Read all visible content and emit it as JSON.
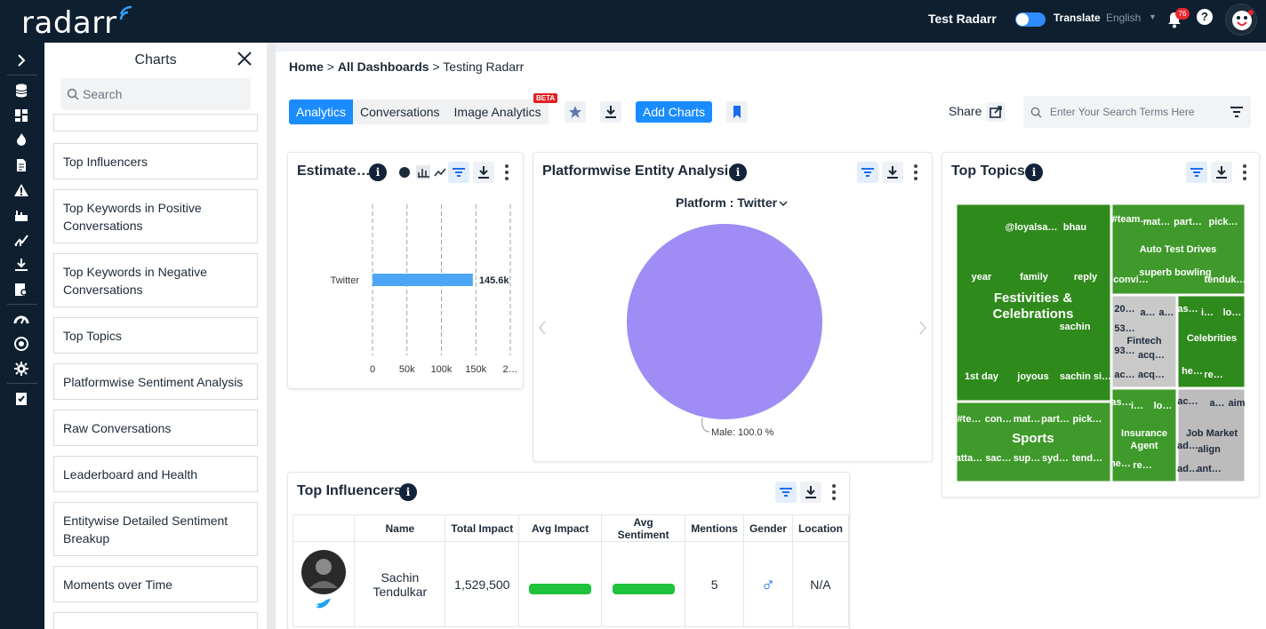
{
  "app": {
    "logo_text": "radarr"
  },
  "topbar": {
    "user_name": "Test Radarr",
    "translate_label": "Translate",
    "language": "English",
    "notifications": "76"
  },
  "charts_panel": {
    "title": "Charts",
    "search_placeholder": "Search",
    "items": [
      "Top Influencers",
      "Top Keywords in Positive Conversations",
      "Top Keywords in Negative Conversations",
      "Top Topics",
      "Platformwise Sentiment Analysis",
      "Raw Conversations",
      "Leaderboard and Health",
      "Entitywise Detailed Sentiment Breakup",
      "Moments over Time"
    ]
  },
  "breadcrumb": {
    "home": "Home",
    "sep1": ">",
    "all_dashboards": "All Dashboards",
    "sep2": ">",
    "current": "Testing Radarr"
  },
  "tabs": [
    "Analytics",
    "Conversations",
    "Image Analytics"
  ],
  "beta_badge": "BETA",
  "toolbar": {
    "add_charts": "Add Charts",
    "share": "Share",
    "search_placeholder": "Enter Your Search Terms Here"
  },
  "estimated_card": {
    "title": "Estimate…",
    "chart_data": {
      "type": "bar",
      "orientation": "horizontal",
      "categories": [
        "Twitter"
      ],
      "values": [
        145600
      ],
      "data_labels": [
        "145.6k"
      ],
      "xlim": [
        0,
        200000
      ],
      "x_ticks": [
        "0",
        "50k",
        "100k",
        "150k",
        "2…"
      ],
      "grid": true,
      "bar_color": "#4da6f5"
    }
  },
  "platformwise_card": {
    "title": "Platformwise Entity Analysis",
    "platform_selector": "Platform : Twitter",
    "chart_data": {
      "type": "pie",
      "slices": [
        {
          "label": "Male",
          "value": 100.0,
          "color": "#a08cf5"
        }
      ],
      "data_label": "Male: 100.0 %"
    }
  },
  "top_topics_card": {
    "title": "Top Topics",
    "chart_data": {
      "type": "heatmap",
      "groups": [
        {
          "name": "Festivities & Celebrations",
          "labels": [
            "@loyalsa…",
            "bhau",
            "year",
            "family",
            "reply",
            "sachin",
            "1st day",
            "joyous",
            "sachin si…"
          ]
        },
        {
          "name": "Auto Test Drives",
          "labels": [
            "#team…",
            "mat…",
            "part…",
            "pick…",
            "convi…",
            "superb bowling",
            "tenduk…"
          ]
        },
        {
          "name": "Fintech",
          "labels": [
            "20…",
            "a…",
            "a…",
            "53…",
            "93…",
            "acq…",
            "ac…",
            "acq…"
          ]
        },
        {
          "name": "Celebrities",
          "labels": [
            "as…",
            "i…",
            "lo…",
            "he…",
            "re…"
          ]
        },
        {
          "name": "Sports",
          "labels": [
            "#te…",
            "con…",
            "mat…",
            "part…",
            "pick…",
            "atta…",
            "sac…",
            "sup…",
            "syd…",
            "tend…"
          ]
        },
        {
          "name": "Insurance Agent",
          "labels": [
            "as…",
            "i…",
            "lo…",
            "he…",
            "re…"
          ]
        },
        {
          "name": "Job Market",
          "labels": [
            "ac…",
            "a…",
            "aim",
            "ad…",
            "align",
            "ad…",
            "ant…"
          ]
        }
      ]
    }
  },
  "top_influencers_card": {
    "title": "Top Influencers",
    "columns": [
      "Name",
      "Total Impact",
      "Avg Impact",
      "Avg Sentiment",
      "Mentions",
      "Gender",
      "Location"
    ],
    "rows": [
      {
        "name": "Sachin Tendulkar",
        "total_impact": "1,529,500",
        "mentions": "5",
        "gender": "♂",
        "location": "N/A"
      }
    ]
  }
}
